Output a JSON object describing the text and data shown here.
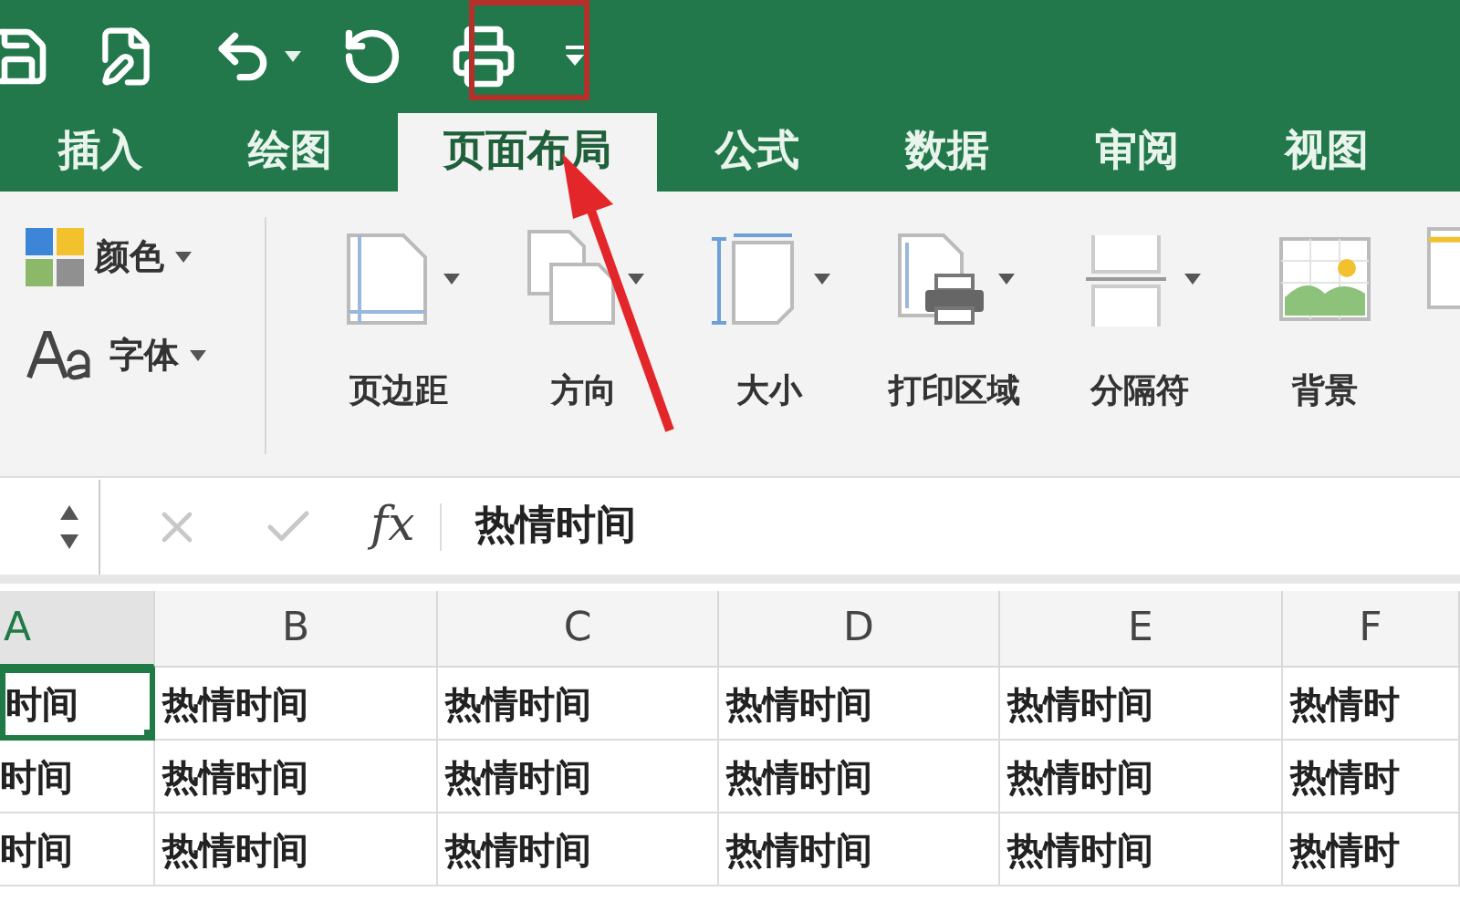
{
  "tabs": [
    {
      "label": "插入",
      "selected": false
    },
    {
      "label": "绘图",
      "selected": false
    },
    {
      "label": "页面布局",
      "selected": true
    },
    {
      "label": "公式",
      "selected": false
    },
    {
      "label": "数据",
      "selected": false
    },
    {
      "label": "审阅",
      "selected": false
    },
    {
      "label": "视图",
      "selected": false
    }
  ],
  "ribbon": {
    "theme_buttons": [
      {
        "kind": "colors",
        "label": "颜色"
      },
      {
        "kind": "fonts",
        "label": "字体"
      }
    ],
    "page_setup_buttons": [
      {
        "kind": "margins",
        "label": "页边距",
        "has_menu": true
      },
      {
        "kind": "orientation",
        "label": "方向",
        "has_menu": true
      },
      {
        "kind": "size",
        "label": "大小",
        "has_menu": true
      },
      {
        "kind": "print_area",
        "label": "打印区域",
        "has_menu": true
      },
      {
        "kind": "breaks",
        "label": "分隔符",
        "has_menu": true
      },
      {
        "kind": "background",
        "label": "背景",
        "has_menu": false
      }
    ]
  },
  "formula_bar": {
    "function_label": "fx",
    "value": "热情时间"
  },
  "sheet": {
    "columns": [
      {
        "label": "A",
        "selected": true
      },
      {
        "label": "B",
        "selected": false
      },
      {
        "label": "C",
        "selected": false
      },
      {
        "label": "D",
        "selected": false
      },
      {
        "label": "E",
        "selected": false
      },
      {
        "label": "F",
        "selected": false
      }
    ],
    "rows": [
      {
        "cells": [
          {
            "text": "时间",
            "selected": true
          },
          {
            "text": "热情时间",
            "selected": false
          },
          {
            "text": "热情时间",
            "selected": false
          },
          {
            "text": "热情时间",
            "selected": false
          },
          {
            "text": "热情时间",
            "selected": false
          },
          {
            "text": "热情时",
            "selected": false
          }
        ]
      },
      {
        "cells": [
          {
            "text": "时间",
            "selected": false
          },
          {
            "text": "热情时间",
            "selected": false
          },
          {
            "text": "热情时间",
            "selected": false
          },
          {
            "text": "热情时间",
            "selected": false
          },
          {
            "text": "热情时间",
            "selected": false
          },
          {
            "text": "热情时",
            "selected": false
          }
        ]
      },
      {
        "cells": [
          {
            "text": "时间",
            "selected": false
          },
          {
            "text": "热情时间",
            "selected": false
          },
          {
            "text": "热情时间",
            "selected": false
          },
          {
            "text": "热情时间",
            "selected": false
          },
          {
            "text": "热情时间",
            "selected": false
          },
          {
            "text": "热情时",
            "selected": false
          }
        ]
      }
    ]
  }
}
